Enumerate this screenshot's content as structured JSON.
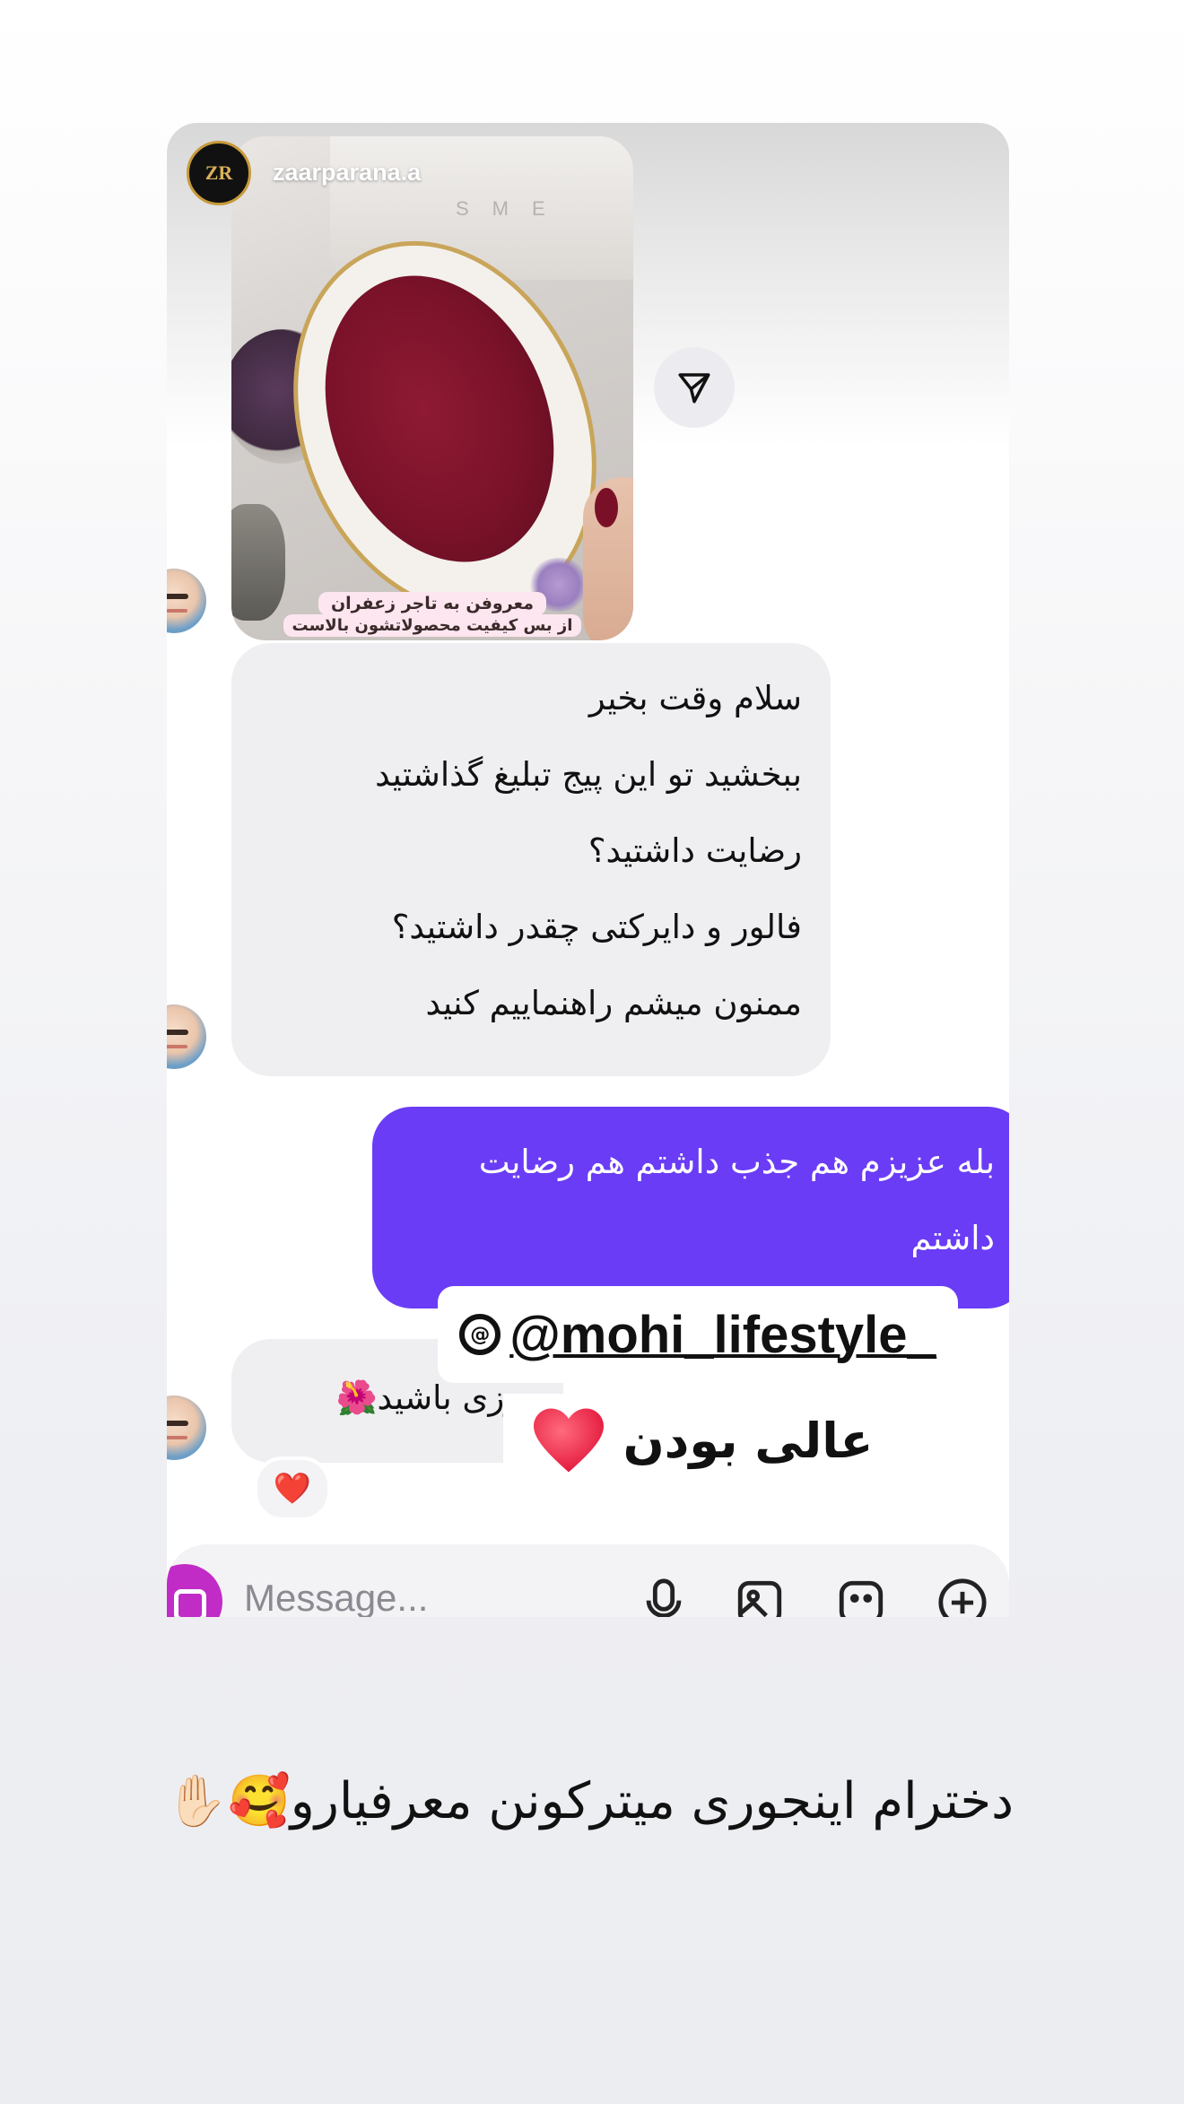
{
  "post": {
    "username": "zaarparana.a",
    "logo_text": "ZR",
    "appliance_text": "SME",
    "caption_line1": "معروفن به تاجر زعفران",
    "caption_line2": "از بس کیفیت محصولاتشون بالاست"
  },
  "messages": {
    "incoming_1": [
      "سلام وقت بخیر",
      "ببخشید تو این پیج تبلیغ گذاشتید",
      "رضایت داشتید؟",
      "فالور و دایرکتی چقدر داشتید؟",
      "ممنون میشم راهنماییم کنید"
    ],
    "outgoing_1": [
      "بله عزیزم هم جذب داشتم هم رضایت",
      "داشتم"
    ],
    "incoming_2": "روزی باشید🌺",
    "reaction": "❤️"
  },
  "overlay": {
    "mention": "@mohi_lifestyle_",
    "good_text": "عالی بودن",
    "heart": "❤️"
  },
  "composer": {
    "placeholder": "Message..."
  },
  "footer_caption": "دخترام اینجوری میترکونن معرفیارو🥰✋🏻",
  "colors": {
    "outgoing_bubble": "#6a3cf6",
    "incoming_bubble": "#efeff2",
    "camera_button": "#c02cc5"
  }
}
